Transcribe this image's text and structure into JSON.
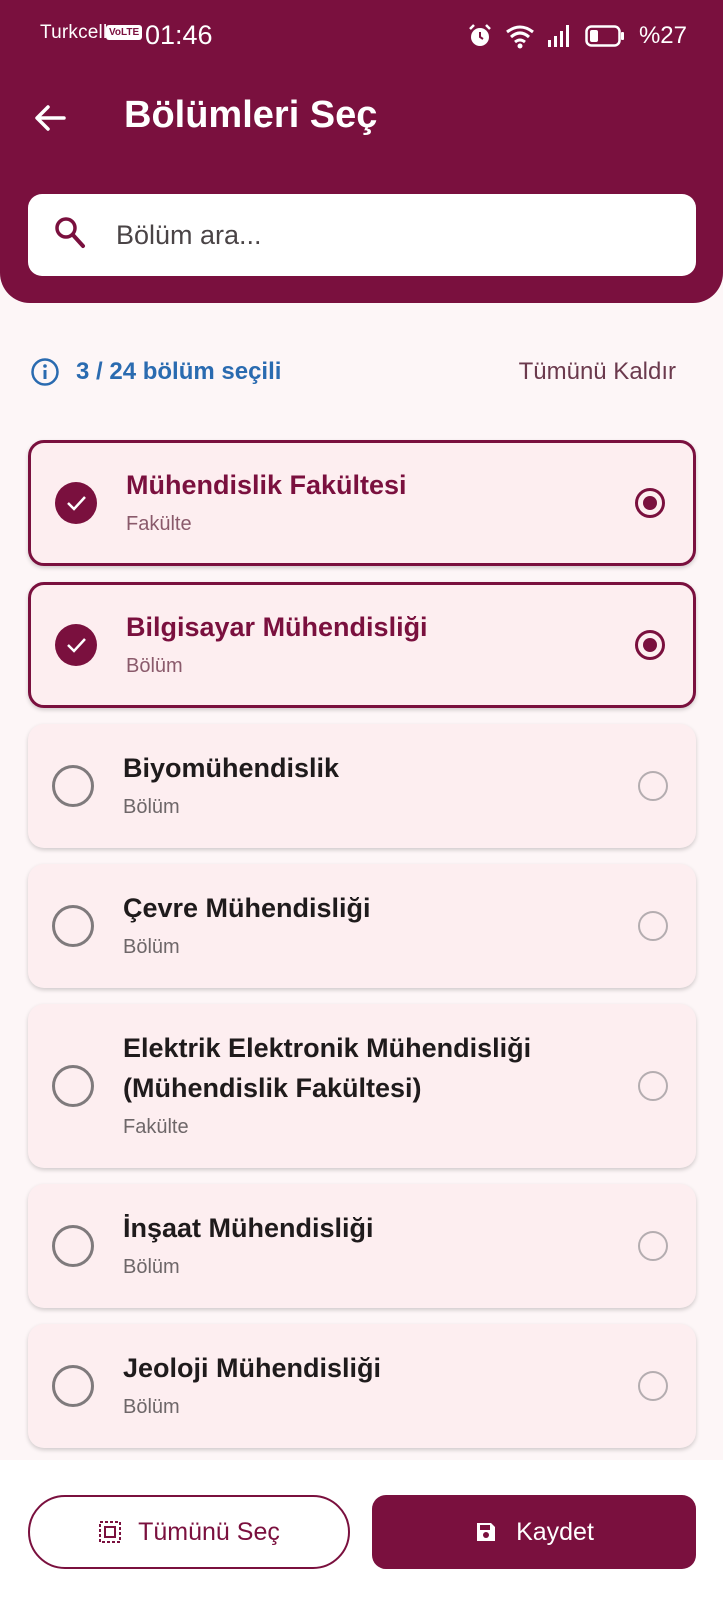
{
  "status_bar": {
    "carrier": "Turkcell",
    "volte": "VoLTE",
    "time": "01:46",
    "battery": "%27"
  },
  "header": {
    "title": "Bölümleri Seç"
  },
  "search": {
    "placeholder": "Bölüm ara..."
  },
  "selection": {
    "info": "3 / 24 bölüm seçili",
    "clear_all_label": "Tümünü Kaldır"
  },
  "departments": [
    {
      "name": "Mühendislik Fakültesi",
      "type": "Fakülte",
      "selected": true
    },
    {
      "name": "Bilgisayar Mühendisliği",
      "type": "Bölüm",
      "selected": true
    },
    {
      "name": "Biyomühendislik",
      "type": "Bölüm",
      "selected": false
    },
    {
      "name": "Çevre Mühendisliği",
      "type": "Bölüm",
      "selected": false
    },
    {
      "name": "Elektrik Elektronik Mühendisliği (Mühendislik Fakültesi)",
      "type": "Fakülte",
      "selected": false
    },
    {
      "name": "İnşaat Mühendisliği",
      "type": "Bölüm",
      "selected": false
    },
    {
      "name": "Jeoloji Mühendisliği",
      "type": "Bölüm",
      "selected": false
    }
  ],
  "actions": {
    "select_all_label": "Tümünü Seç",
    "save_label": "Kaydet"
  },
  "colors": {
    "primary": "#7a103e",
    "info": "#2a6bb0",
    "card_bg": "#fdeef0"
  }
}
